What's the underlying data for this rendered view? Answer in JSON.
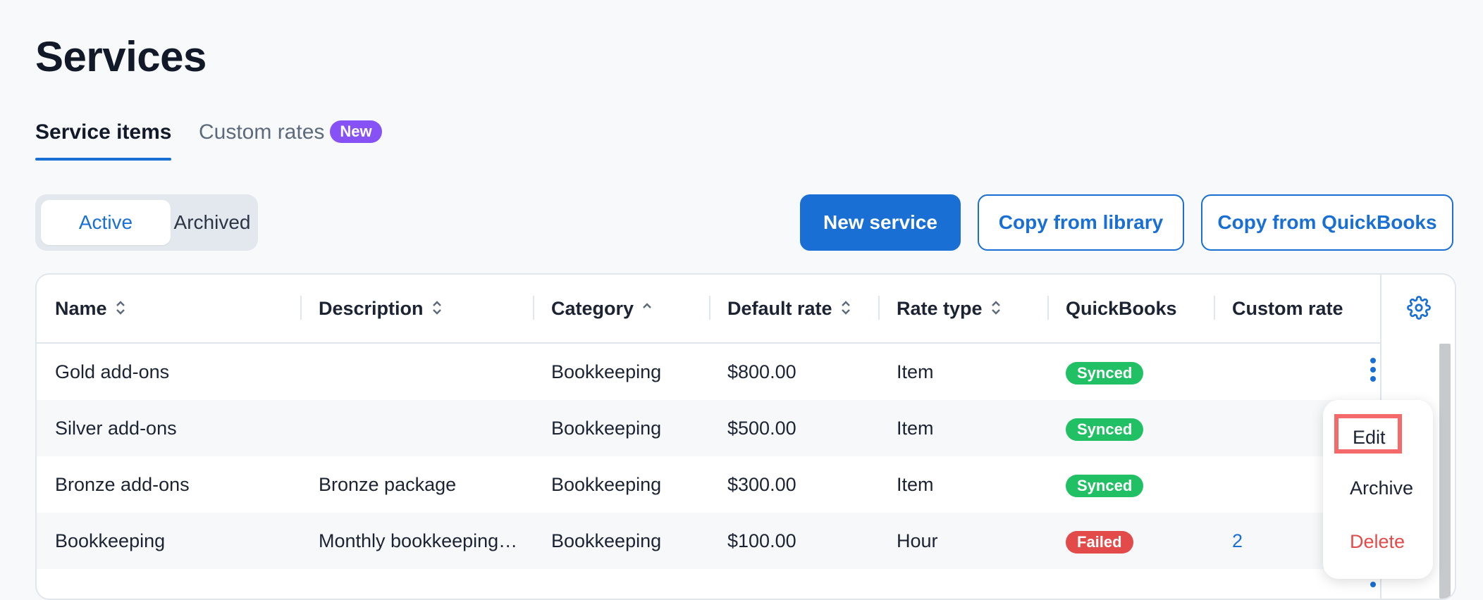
{
  "page": {
    "title": "Services"
  },
  "tabs": [
    {
      "label": "Service items",
      "active": true
    },
    {
      "label": "Custom rates",
      "badge": "New",
      "active": false
    }
  ],
  "filter": {
    "active_label": "Active",
    "archived_label": "Archived",
    "selected": "Active"
  },
  "actions": {
    "new_service": "New service",
    "copy_library": "Copy from library",
    "copy_quickbooks": "Copy from QuickBooks"
  },
  "table": {
    "columns": [
      {
        "label": "Name",
        "sort": "both"
      },
      {
        "label": "Description",
        "sort": "both"
      },
      {
        "label": "Category",
        "sort": "asc"
      },
      {
        "label": "Default rate",
        "sort": "both"
      },
      {
        "label": "Rate type",
        "sort": "both"
      },
      {
        "label": "QuickBooks",
        "sort": "none"
      },
      {
        "label": "Custom rate",
        "sort": "none"
      }
    ],
    "rows": [
      {
        "name": "Gold add-ons",
        "description": "",
        "category": "Bookkeeping",
        "default_rate": "$800.00",
        "rate_type": "Item",
        "quickbooks": "Synced",
        "custom_rate": ""
      },
      {
        "name": "Silver add-ons",
        "description": "",
        "category": "Bookkeeping",
        "default_rate": "$500.00",
        "rate_type": "Item",
        "quickbooks": "Synced",
        "custom_rate": ""
      },
      {
        "name": "Bronze add-ons",
        "description": "Bronze package",
        "category": "Bookkeeping",
        "default_rate": "$300.00",
        "rate_type": "Item",
        "quickbooks": "Synced",
        "custom_rate": ""
      },
      {
        "name": "Bookkeeping",
        "description": "Monthly bookkeeping…",
        "category": "Bookkeeping",
        "default_rate": "$100.00",
        "rate_type": "Hour",
        "quickbooks": "Failed",
        "custom_rate": "2"
      }
    ]
  },
  "row_menu": {
    "edit": "Edit",
    "archive": "Archive",
    "delete": "Delete"
  },
  "colors": {
    "accent": "#1a6fd4",
    "synced": "#22c064",
    "failed": "#e34b4b",
    "badge": "#8752f5",
    "highlight": "#f46a6a"
  },
  "icons": [
    "gear-icon",
    "sort-icon",
    "sort-asc-icon",
    "more-vertical-icon"
  ]
}
